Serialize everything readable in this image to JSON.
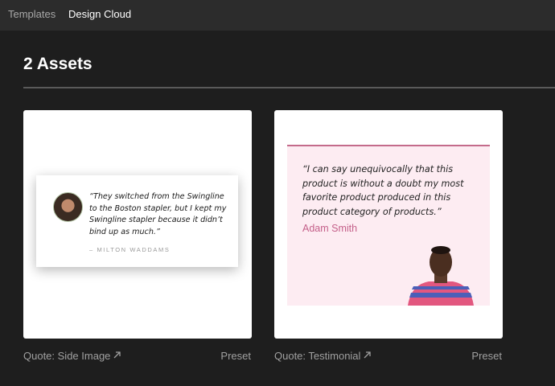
{
  "nav": {
    "tabs": [
      {
        "label": "Templates"
      },
      {
        "label": "Design Cloud"
      }
    ]
  },
  "main": {
    "heading": "2 Assets"
  },
  "cards": [
    {
      "caption": "Quote: Side Image",
      "caption_icon": "arrow-up-right-icon",
      "preset_label": "Preset",
      "quote": "“They switched from the Swingline to the Boston stapler, but I kept my Swingline stapler because it didn’t bind up as much.”",
      "author": "– MILTON WADDAMS"
    },
    {
      "caption": "Quote: Testimonial",
      "caption_icon": "arrow-up-right-icon",
      "preset_label": "Preset",
      "quote": "“I can say unequivocally that this product is without a doubt my most favorite product produced in this product category of products.”",
      "author": "Adam Smith"
    }
  ],
  "colors": {
    "background": "#1e1e1e",
    "topbar": "#2c2c2c",
    "testimonial_bg": "#fdecf2",
    "testimonial_accent": "#c45f89"
  }
}
